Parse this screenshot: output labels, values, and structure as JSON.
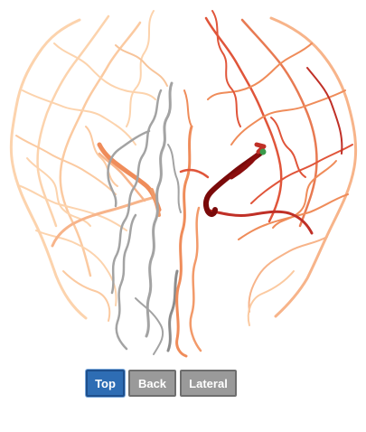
{
  "toolbar": {
    "buttons": [
      {
        "label": "Top",
        "active": true
      },
      {
        "label": "Back",
        "active": false
      },
      {
        "label": "Lateral",
        "active": false
      }
    ]
  },
  "colors": {
    "light_peach": "#fcd3ad",
    "peach": "#f7b48a",
    "orange": "#ef8c5a",
    "red_orange": "#e0553a",
    "crimson": "#c03027",
    "dark_red": "#7a0a0a",
    "gray": "#a3a3a3",
    "dark_gray": "#8c8c8c",
    "green_marker": "#3a9a4a",
    "button_active": "#2e6db4",
    "button_inactive": "#9a9a9a"
  }
}
